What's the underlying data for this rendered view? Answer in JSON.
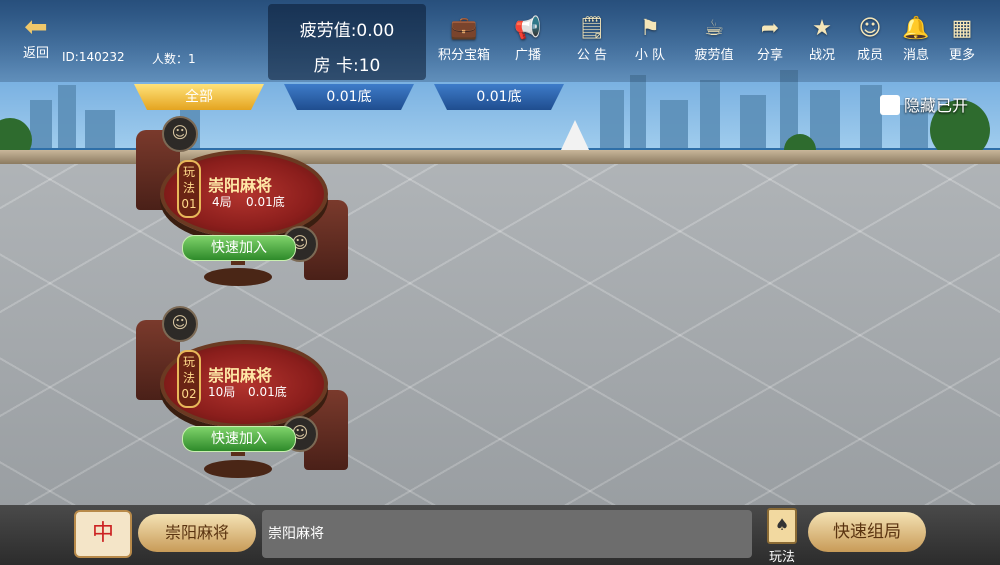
{
  "header": {
    "back_label": "返回",
    "user_id": "ID:140232",
    "people_count": "人数：1",
    "fatigue": "疲劳值:0.00",
    "room_cards": "房  卡:10"
  },
  "menu": [
    {
      "label": "积分宝箱",
      "icon": "treasure-chest-icon"
    },
    {
      "label": "广播",
      "icon": "megaphone-icon"
    },
    {
      "label": "公 告",
      "icon": "notice-icon"
    },
    {
      "label": "小 队",
      "icon": "flag-icon"
    },
    {
      "label": "疲劳值",
      "icon": "coffee-cup-icon"
    },
    {
      "label": "分享",
      "icon": "share-icon"
    },
    {
      "label": "战况",
      "icon": "medal-icon"
    },
    {
      "label": "成员",
      "icon": "members-icon"
    },
    {
      "label": "消息",
      "icon": "bell-icon"
    },
    {
      "label": "更多",
      "icon": "grid-icon"
    }
  ],
  "tabs": [
    {
      "label": "全部",
      "active": true
    },
    {
      "label": "0.01底",
      "active": false
    },
    {
      "label": "0.01底",
      "active": false
    }
  ],
  "hide_toggle_label": "隐藏已开",
  "tables": [
    {
      "rule_tag": "玩\n法\n01",
      "game": "崇阳麻将",
      "rounds": "4局",
      "base": "0.01底",
      "join_label": "快速加入"
    },
    {
      "rule_tag": "玩\n法\n02",
      "game": "崇阳麻将",
      "rounds": "10局",
      "base": "0.01底",
      "join_label": "快速加入"
    }
  ],
  "bottom": {
    "mahjong_tile": "中",
    "game_button": "崇阳麻将",
    "description": "崇阳麻将",
    "rules_label": "玩法",
    "quick_start": "快速组局"
  },
  "colors": {
    "tab_active": "#e4a420",
    "tab_inactive": "#1f4d8f",
    "join_button": "#2e8a2a",
    "table_felt": "#8b1e1c"
  }
}
